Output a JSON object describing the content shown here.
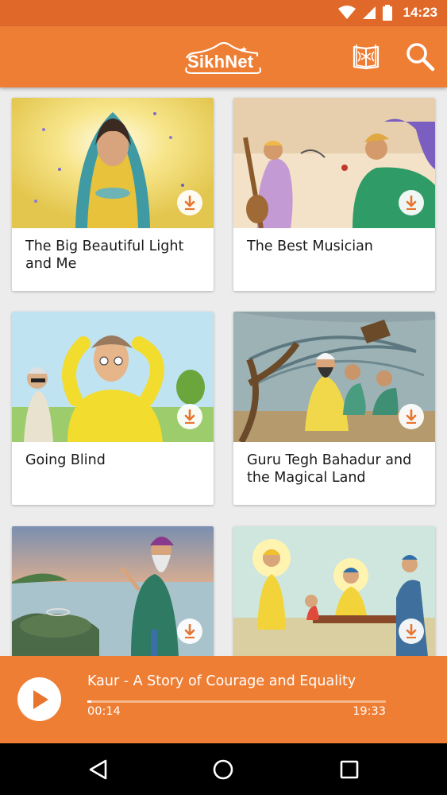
{
  "status_bar": {
    "time": "14:23"
  },
  "app_bar": {
    "logo_text": "SikhNet"
  },
  "stories": [
    {
      "title": "The Big Beautiful Light and Me"
    },
    {
      "title": "The Best Musician"
    },
    {
      "title": "Going Blind"
    },
    {
      "title": "Guru Tegh Bahadur and the Magical Land"
    },
    {
      "title": ""
    },
    {
      "title": ""
    }
  ],
  "player": {
    "track_title": "Kaur - A Story of Courage and Equality",
    "current_time": "00:14",
    "total_time": "19:33",
    "progress": 0.012
  },
  "colors": {
    "primary": "#ef7e35",
    "status_bar": "#e0692a",
    "accent": "#e8742e"
  }
}
